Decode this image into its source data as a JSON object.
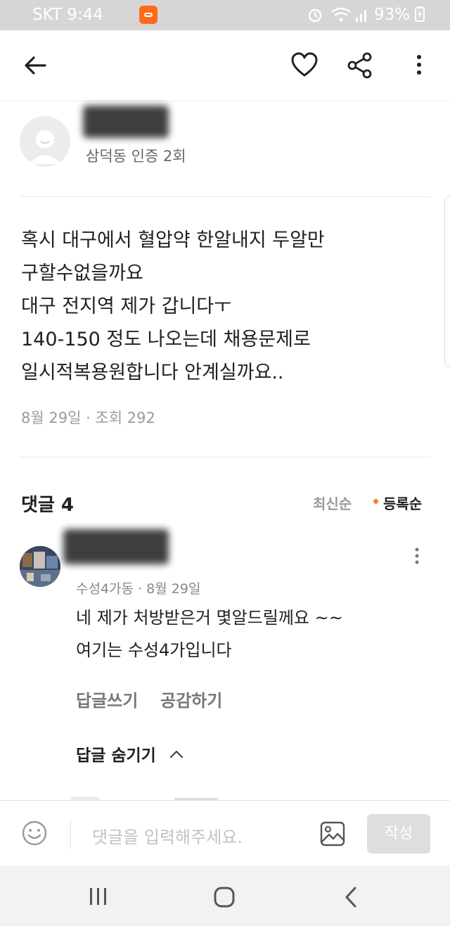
{
  "status_bar": {
    "carrier_time": "SKT 9:44",
    "battery": "93%"
  },
  "post": {
    "location": "삼덕동 인증 2회",
    "lines": [
      "혹시 대구에서 혈압약 한알내지 두알만",
      "구할수없을까요",
      "대구 전지역 제가 갑니다ㅜ",
      "140-150 정도 나오는데 채용문제로",
      "일시적복용원합니다 안계실까요.."
    ],
    "date": "8월 29일",
    "views": "조회 292"
  },
  "comments": {
    "title": "댓글 4",
    "sort_latest": "최신순",
    "sort_registered": "등록순",
    "items": [
      {
        "meta": "수성4가동 · 8월 29일",
        "lines": [
          "네 제가 처방받은거 몇알드릴께요 ~~",
          "여기는 수성4가입니다"
        ],
        "reply_label": "답글쓰기",
        "like_label": "공감하기",
        "hide_replies_label": "답글 숨기기"
      }
    ]
  },
  "input": {
    "placeholder": "댓글을 입력해주세요.",
    "submit_label": "작성"
  },
  "colors": {
    "accent": "#ff7e36",
    "status_bar": "#d6d6d6"
  }
}
